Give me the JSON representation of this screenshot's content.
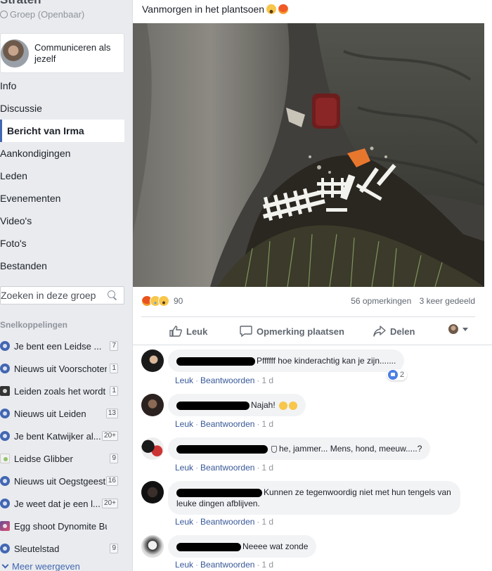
{
  "sidebar": {
    "group_name": "Straten",
    "group_privacy": "Groep (Openbaar)",
    "act_as": "Communiceren als jezelf",
    "nav": [
      {
        "label": "Info",
        "active": false
      },
      {
        "label": "Discussie",
        "active": false
      },
      {
        "label": "Bericht van Irma",
        "active": true
      },
      {
        "label": "Aankondigingen",
        "active": false
      },
      {
        "label": "Leden",
        "active": false
      },
      {
        "label": "Evenementen",
        "active": false
      },
      {
        "label": "Video's",
        "active": false
      },
      {
        "label": "Foto's",
        "active": false
      },
      {
        "label": "Bestanden",
        "active": false
      }
    ],
    "search_placeholder": "Zoeken in deze groep",
    "shortcuts_header": "Snelkoppelingen",
    "shortcuts": [
      {
        "label": "Je bent een Leidse ...",
        "count": "7",
        "icon": "group-icon"
      },
      {
        "label": "Nieuws uit Voorschoten",
        "count": "1",
        "icon": "group-icon"
      },
      {
        "label": "Leiden zoals het wordt",
        "count": "1",
        "icon": "camera-icon"
      },
      {
        "label": "Nieuws uit Leiden",
        "count": "13",
        "icon": "group-icon"
      },
      {
        "label": "Je bent Katwijker al...",
        "count": "20+",
        "icon": "group-icon"
      },
      {
        "label": "Leidse Glibber",
        "count": "9",
        "icon": "slime-icon"
      },
      {
        "label": "Nieuws uit Oegstgeest",
        "count": "16",
        "icon": "group-icon"
      },
      {
        "label": "Je weet dat je een l...",
        "count": "20+",
        "icon": "group-icon"
      },
      {
        "label": "Egg shoot Dynomite Bu...",
        "count": "",
        "icon": "image-icon"
      },
      {
        "label": "Sleutelstad",
        "count": "9",
        "icon": "group-icon"
      }
    ],
    "more": "Meer weergeven"
  },
  "post": {
    "text": "Vanmorgen in het plantsoen",
    "reaction_count": "90",
    "comments_count": "56 opmerkingen",
    "shares": "3 keer gedeeld",
    "actions": {
      "like": "Leuk",
      "comment": "Opmerking plaatsen",
      "share": "Delen"
    }
  },
  "comments": [
    {
      "text": "Pffffff hoe kinderachtig kan je zijn.......",
      "like": "Leuk",
      "reply": "Beantwoorden",
      "age": "1 d",
      "likes": "2"
    },
    {
      "text": "Najah!",
      "like": "Leuk",
      "reply": "Beantwoorden",
      "age": "1 d"
    },
    {
      "text": "he, jammer... Mens, hond, meeuw.....?",
      "like": "Leuk",
      "reply": "Beantwoorden",
      "age": "1 d"
    },
    {
      "text": "Kunnen ze tegenwoordig niet met hun tengels van leuke dingen afblijven.",
      "like": "Leuk",
      "reply": "Beantwoorden",
      "age": "1 d"
    },
    {
      "text": "Neeee wat zonde",
      "like": "Leuk",
      "reply": "Beantwoorden",
      "age": "1 d"
    }
  ],
  "colors": {
    "accent": "#4267b2",
    "link": "#385898",
    "background": "#e9ebee"
  }
}
